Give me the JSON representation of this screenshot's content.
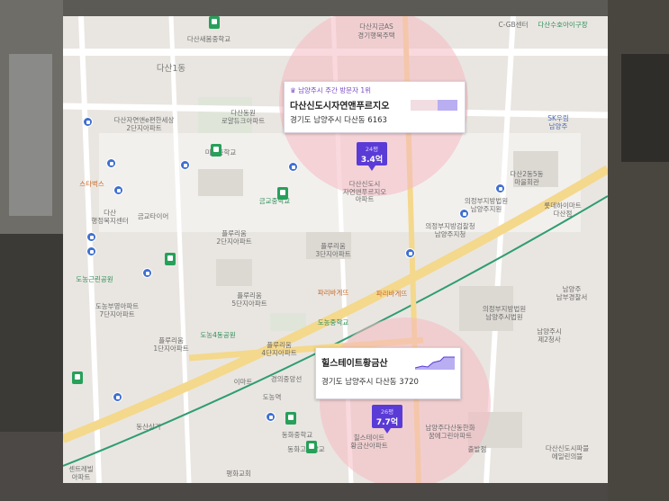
{
  "colors": {
    "room_wall": "#3a3936",
    "map_bg": "#e9e6e1",
    "road_yellow": "#f4d88c",
    "highlight_circle": "#f6b9c3",
    "pin_purple": "#5a3bd6",
    "bus_blue": "#3f6fd0",
    "school_green": "#27a05a",
    "rail_green": "#2f9d72"
  },
  "labels": {
    "dasan1dong": "다산1동",
    "dasan_saebom_middle": "다산새봄중학교",
    "dasan_jigeum_as": "다산지금AS",
    "gyeonggi_haengbok": "경기행복주택",
    "dasan_jayeon_ap": "다산자연앤e편한세상\n2단지아파트",
    "dasan_dongbu": "다산동원\n로얄듀크아파트",
    "migeum_middle": "미금중학교",
    "starbucks": "스타벅스",
    "dasan_haengjeong": "다산\n행정복지센터",
    "geumgyo": "금교타이어",
    "geumgyo_school": "금교중학교",
    "dasan_sindo": "다산신도시\n자연앤푸르지오\n아파트",
    "prugio2": "플루리움\n2단지아파트",
    "prugio3": "플루리움\n3단지아파트",
    "prugio5": "플루리움\n5단지아파트",
    "prugio1": "플루리움\n1단지아파트",
    "prugio4": "플루리움\n4단지아파트",
    "dongbu_park": "도농근린공원",
    "dongbu_apts": "도농부영아파트\n7단지아파트",
    "dongnong_park": "도농4동공원",
    "dongbu_middle": "도농중학교",
    "paris": "파리바게뜨",
    "paris2": "파리바게뜨",
    "emart": "이마트",
    "dongnong_station": "도농역",
    "police": "경의중앙선",
    "dasan2dong": "다산2동5동\n마을회관",
    "uijeongbu_court": "의정부지방법원\n남양주지원",
    "uijeongbu_office": "의정부지방검찰청\n남양주지청",
    "namyangju_police": "남양주\n남부경찰서",
    "namyangju_court2": "의정부지방법원\n남양주시법원",
    "namyangju_2": "남양주시\n제2청사",
    "hana_bank": "남양주다산동한화\n꿈에그린아파트",
    "sk_plaza": "SK우림\n남양주",
    "lotte": "롯데하이마트\n다산점",
    "dasan_hospital": "다산수호아이구장",
    "dongwha": "동화중학교",
    "dongwha_elem": "동화고등학교",
    "pyeonghwa": "평화교회",
    "dongsan": "동산상가",
    "sentral": "센트레빌\n아파트",
    "dasan_foot": "다산신도시파블\n에일린의뜰",
    "chulbalgeom": "출발점",
    "hill_label": "힐스테이트\n황금산아파트",
    "cf": "C-GB센터"
  },
  "card_top": {
    "rank": "♛ 남양주시 주간 방문자 1위",
    "title": "다산신도시자연앤푸르지오",
    "addr": "경기도 남양주시 다산동 6163",
    "pin_size": "24평",
    "pin_price": "3.4억"
  },
  "card_bottom": {
    "title": "힐스테이트황금산",
    "addr": "경기도 남양주시 다산동 3720",
    "pin_size": "26평",
    "pin_price": "7.7억"
  }
}
